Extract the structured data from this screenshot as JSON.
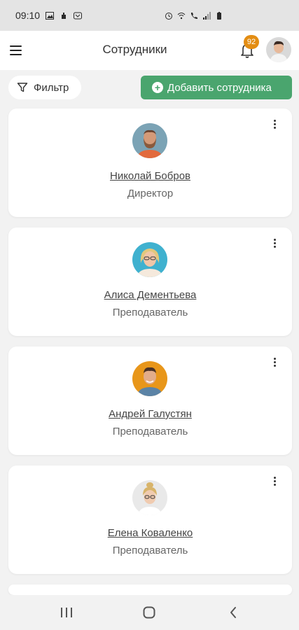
{
  "status_bar": {
    "time": "09:10"
  },
  "header": {
    "title": "Сотрудники",
    "notification_count": "92",
    "menu_icon": "hamburger-icon",
    "bell_icon": "bell-icon"
  },
  "toolbar": {
    "filter_label": "Фильтр",
    "add_label": "Добавить сотрудника",
    "accent_color": "#4aa56e"
  },
  "employees": [
    {
      "name": "Николай Бобров",
      "role": "Директор",
      "avatar_bg": "#7ba3b5"
    },
    {
      "name": "Алиса Дементьева",
      "role": "Преподаватель",
      "avatar_bg": "#3fb1cf"
    },
    {
      "name": "Андрей Галустян",
      "role": "Преподаватель",
      "avatar_bg": "#e8961a"
    },
    {
      "name": "Елена Коваленко",
      "role": "Преподаватель",
      "avatar_bg": "#e9e9e9"
    }
  ],
  "colors": {
    "badge": "#e38d13",
    "background": "#f2f2f2"
  }
}
